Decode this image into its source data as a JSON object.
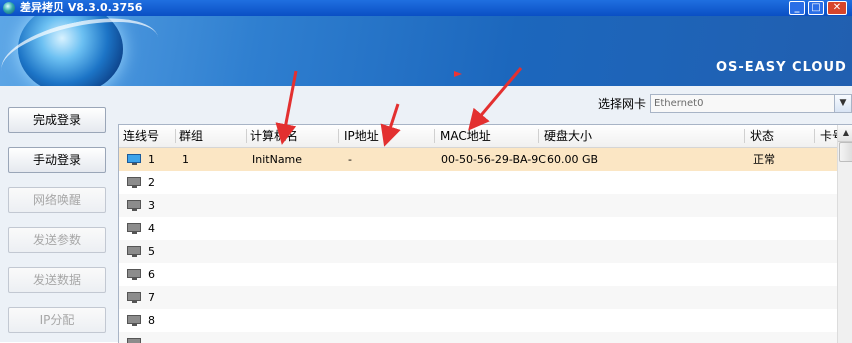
{
  "window": {
    "title": "差异拷贝 V8.3.0.3756",
    "min_glyph": "_",
    "max_glyph": "□",
    "close_glyph": "✕"
  },
  "banner": {
    "brand": "OS-EASY CLOUD"
  },
  "sidebar": {
    "buttons": [
      {
        "label": "完成登录",
        "enabled": true
      },
      {
        "label": "手动登录",
        "enabled": true
      },
      {
        "label": "网络唤醒",
        "enabled": false
      },
      {
        "label": "发送参数",
        "enabled": false
      },
      {
        "label": "发送数据",
        "enabled": false
      },
      {
        "label": "IP分配",
        "enabled": false
      }
    ]
  },
  "nic": {
    "label": "选择网卡",
    "value": "Ethernet0",
    "arrow": "▼"
  },
  "table": {
    "columns": [
      "连线号",
      "群组",
      "计算机名",
      "IP地址",
      "MAC地址",
      "硬盘大小",
      "状态",
      "卡号"
    ],
    "rows": [
      {
        "num": "1",
        "group": "1",
        "name": "InitName",
        "ip": "-",
        "mac": "00-50-56-29-BA-9C",
        "disk": "60.00 GB",
        "status": "正常",
        "selected": true
      },
      {
        "num": "2",
        "group": "",
        "name": "",
        "ip": "",
        "mac": "",
        "disk": "",
        "status": ""
      },
      {
        "num": "3",
        "group": "",
        "name": "",
        "ip": "",
        "mac": "",
        "disk": "",
        "status": ""
      },
      {
        "num": "4",
        "group": "",
        "name": "",
        "ip": "",
        "mac": "",
        "disk": "",
        "status": ""
      },
      {
        "num": "5",
        "group": "",
        "name": "",
        "ip": "",
        "mac": "",
        "disk": "",
        "status": ""
      },
      {
        "num": "6",
        "group": "",
        "name": "",
        "ip": "",
        "mac": "",
        "disk": "",
        "status": ""
      },
      {
        "num": "7",
        "group": "",
        "name": "",
        "ip": "",
        "mac": "",
        "disk": "",
        "status": ""
      },
      {
        "num": "8",
        "group": "",
        "name": "",
        "ip": "",
        "mac": "",
        "disk": "",
        "status": ""
      }
    ],
    "scroll_up": "▲"
  },
  "colors": {
    "titlebar": "#0a4fc4",
    "selected_row": "#fbe6c4",
    "annotation_arrow": "#e33030",
    "disabled_text": "#a7a7a7"
  },
  "icons": {
    "row": "computer-icon",
    "app": "globe-icon"
  }
}
